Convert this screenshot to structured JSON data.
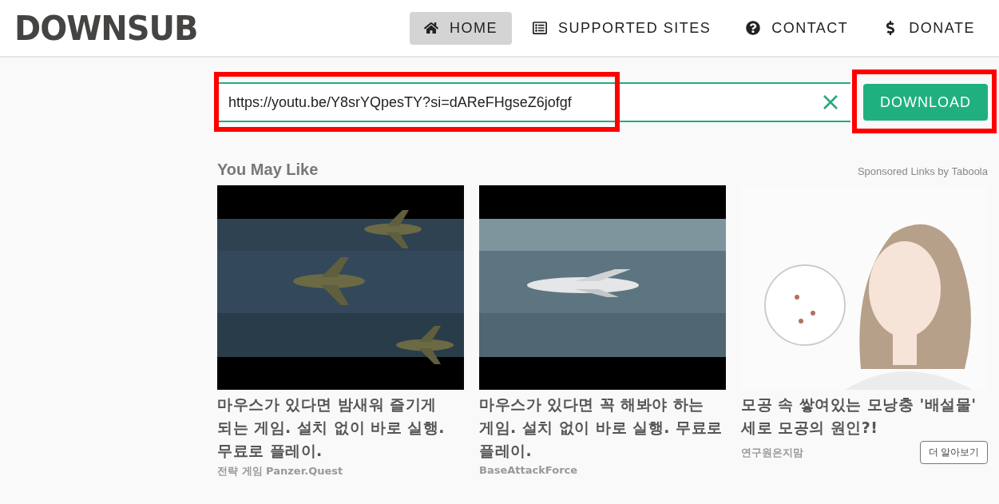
{
  "header": {
    "logo": "DOWNSUB",
    "nav": [
      {
        "label": "HOME",
        "selected": true
      },
      {
        "label": "SUPPORTED SITES",
        "selected": false
      },
      {
        "label": "CONTACT",
        "selected": false
      },
      {
        "label": "DONATE",
        "selected": false
      }
    ]
  },
  "search": {
    "value": "https://youtu.be/Y8srYQpesTY?si=dAReFHgseZ6jofgf",
    "button": "DOWNLOAD"
  },
  "recommendations": {
    "title": "You May Like",
    "sponsor": "Sponsored Links by Taboola",
    "cards": [
      {
        "title": "마우스가 있다면 밤새워 즐기게 되는 게임. 설치 없이 바로 실행. 무료로 플레이.",
        "source": "전략 게임 Panzer.Quest"
      },
      {
        "title": "마우스가 있다면 꼭 해봐야 하는 게임. 설치 없이 바로 실행. 무료로 플레이.",
        "source": "BaseAttackForce"
      },
      {
        "title": "모공 속 쌓여있는 모낭충 '배설물' 세로 모공의 원인?!",
        "source": "연구원은지맘",
        "button": "더 알아보기"
      }
    ]
  }
}
